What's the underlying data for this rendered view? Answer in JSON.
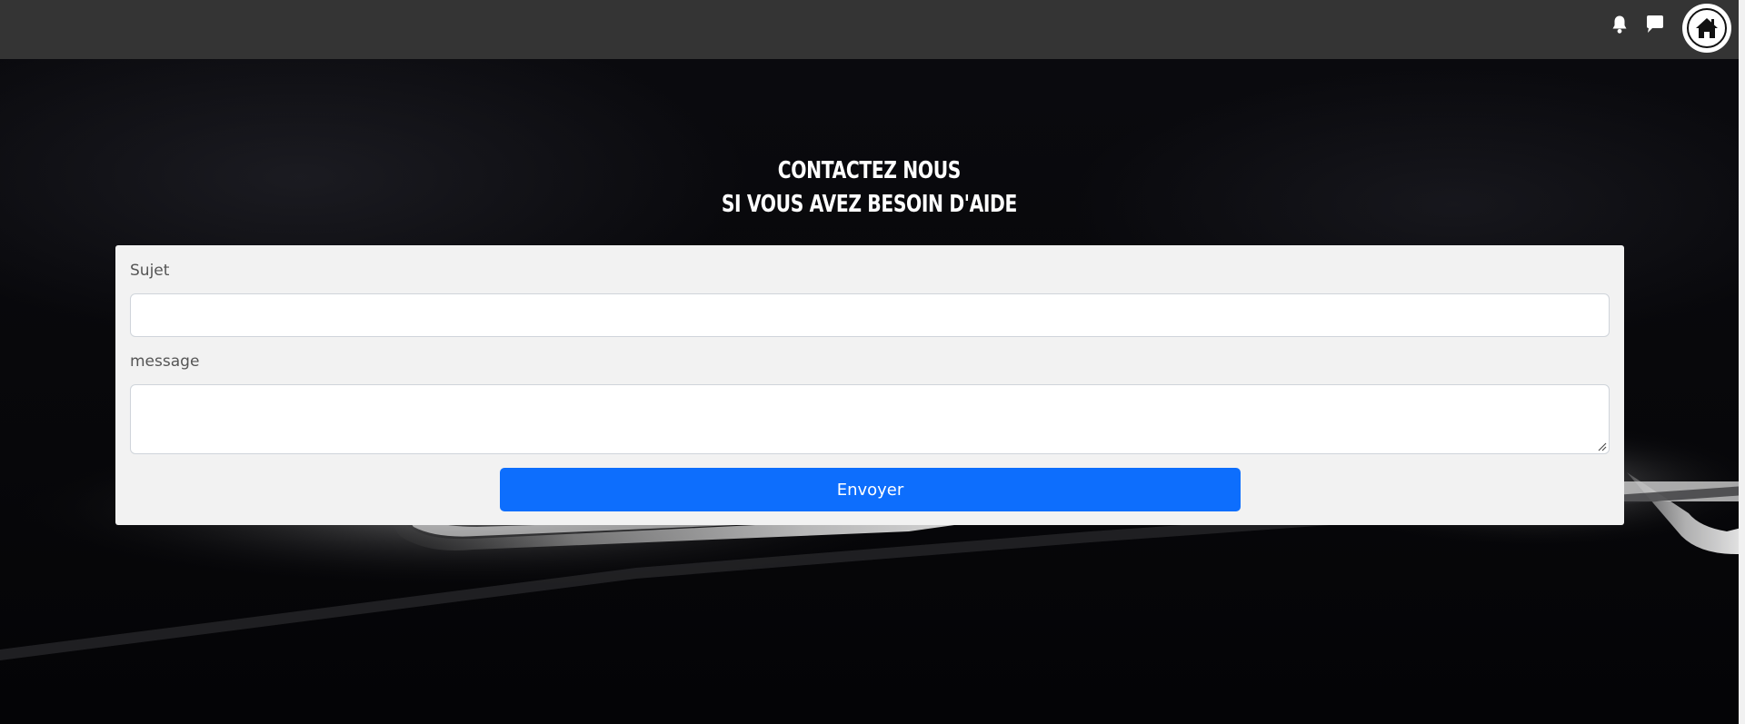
{
  "topbar": {
    "icons": {
      "notifications": "bell-icon",
      "messages": "chat-bubble-icon",
      "home": "home-icon"
    }
  },
  "contact": {
    "title_line1": "Contactez nous",
    "title_line2": "Si vous avez besoin d'aide",
    "subject_label": "Sujet",
    "subject_value": "",
    "message_label": "message",
    "message_value": "",
    "submit_label": "Envoyer"
  },
  "colors": {
    "topbar": "#343434",
    "card": "#f2f2f2",
    "primary_button": "#0d6efd",
    "heading_text": "#ffffff"
  }
}
